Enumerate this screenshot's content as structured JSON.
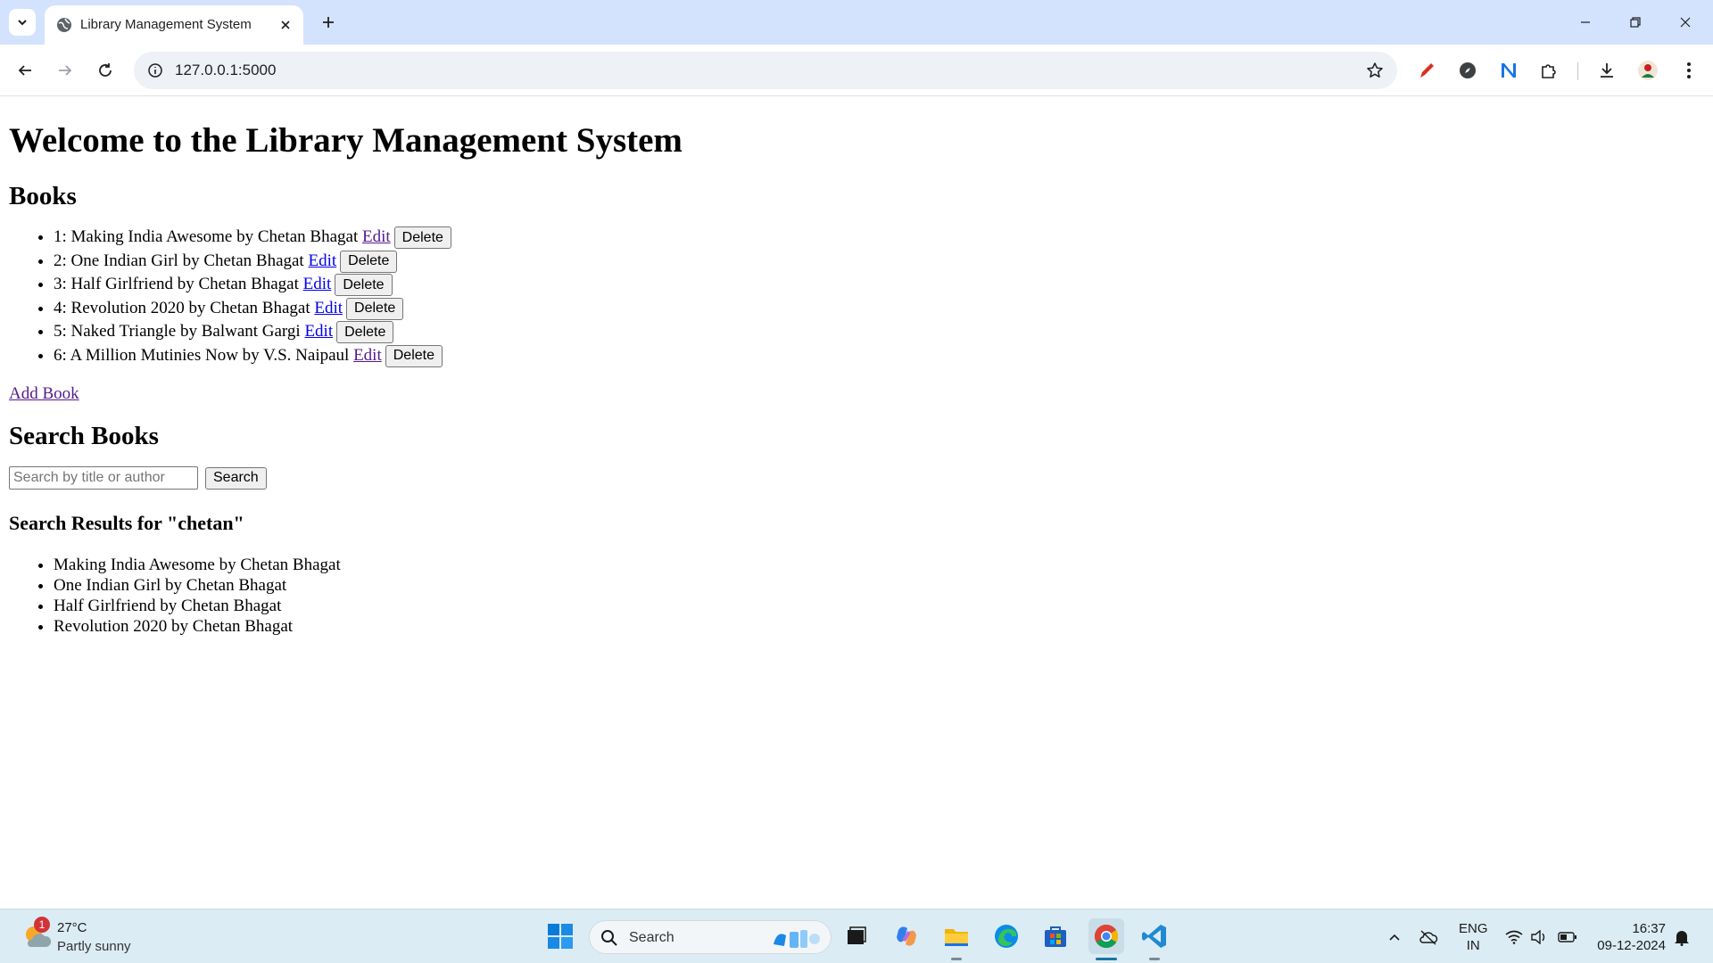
{
  "browser": {
    "tab_title": "Library Management System",
    "url": "127.0.0.1:5000"
  },
  "page": {
    "title": "Welcome to the Library Management System",
    "books_heading": "Books",
    "books": [
      {
        "text": "1: Making India Awesome by Chetan Bhagat",
        "edit_label": "Edit",
        "delete_label": "Delete"
      },
      {
        "text": "2: One Indian Girl by Chetan Bhagat",
        "edit_label": "Edit",
        "delete_label": "Delete"
      },
      {
        "text": "3: Half Girlfriend by Chetan Bhagat",
        "edit_label": "Edit",
        "delete_label": "Delete"
      },
      {
        "text": "4: Revolution 2020 by Chetan Bhagat",
        "edit_label": "Edit",
        "delete_label": "Delete"
      },
      {
        "text": "5: Naked Triangle by Balwant Gargi",
        "edit_label": "Edit",
        "delete_label": "Delete"
      },
      {
        "text": "6: A Million Mutinies Now by V.S. Naipaul",
        "edit_label": "Edit",
        "delete_label": "Delete"
      }
    ],
    "add_book_label": "Add Book",
    "search_heading": "Search Books",
    "search_placeholder": "Search by title or author",
    "search_button_label": "Search",
    "results_heading": "Search Results for \"chetan\"",
    "results": [
      "Making India Awesome by Chetan Bhagat",
      "One Indian Girl by Chetan Bhagat",
      "Half Girlfriend by Chetan Bhagat",
      "Revolution 2020 by Chetan Bhagat"
    ]
  },
  "taskbar": {
    "weather_badge": "1",
    "weather_temp": "27°C",
    "weather_desc": "Partly sunny",
    "search_label": "Search",
    "lang_line1": "ENG",
    "lang_line2": "IN",
    "time": "16:37",
    "date": "09-12-2024"
  },
  "colors": {
    "tabbar_bg": "#d3e3fd",
    "visited_link": "#551a8b",
    "unvisited_link": "#0000ee",
    "taskbar_bg": "#dcecf4"
  }
}
